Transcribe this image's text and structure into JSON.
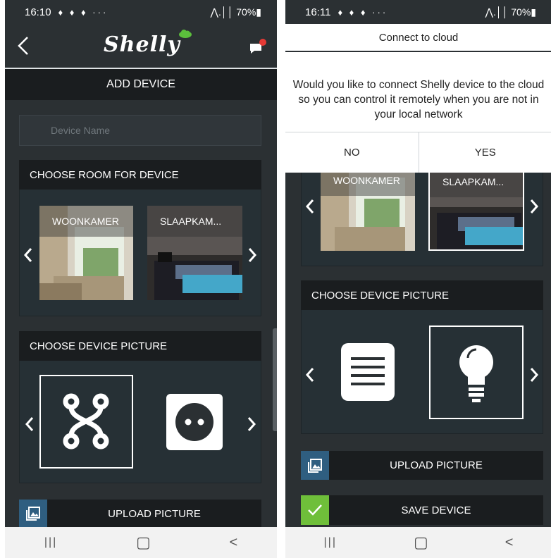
{
  "left": {
    "status": {
      "time": "16:10",
      "icons": "♦ ♦ ♦ ···",
      "right": "⋀.││ 70%▮"
    },
    "header": {
      "logo": "Shelly"
    },
    "title": "ADD DEVICE",
    "device_name_placeholder": "Device Name",
    "room_section": {
      "heading": "CHOOSE ROOM FOR DEVICE",
      "rooms": [
        {
          "label": "WOONKAMER"
        },
        {
          "label": "SLAAPKAM..."
        }
      ]
    },
    "picture_section": {
      "heading": "CHOOSE DEVICE PICTURE"
    },
    "upload_label": "UPLOAD PICTURE"
  },
  "right": {
    "status": {
      "time": "16:11",
      "icons": "♦ ♦ ♦ ···",
      "right": "⋀.││ 70%▮"
    },
    "dialog": {
      "title": "Connect to cloud",
      "message": "Would you like to connect Shelly device to the cloud so you can control it remotely when you are not in your local network",
      "no_label": "NO",
      "yes_label": "YES"
    },
    "rooms": [
      {
        "label": "WOONKAMER"
      },
      {
        "label": "SLAAPKAM..."
      }
    ],
    "picture_section": {
      "heading": "CHOOSE DEVICE PICTURE"
    },
    "upload_label": "UPLOAD PICTURE",
    "save_label": "SAVE DEVICE"
  },
  "navbar": {
    "recent": "|||",
    "home": "▢",
    "back": "<"
  },
  "colors": {
    "background": "#2b3033",
    "panel": "#263035",
    "header_bar": "#1a1d1f",
    "upload_blue": "#2f5e80",
    "save_green": "#6fbf3a",
    "notif_red": "#e53935"
  },
  "icons": [
    "back-chevron-icon",
    "chat-notification-icon",
    "cloud-icon",
    "image-icon",
    "check-icon",
    "scheme-switch-icon",
    "socket-icon",
    "roller-shutter-icon",
    "bulb-icon"
  ]
}
